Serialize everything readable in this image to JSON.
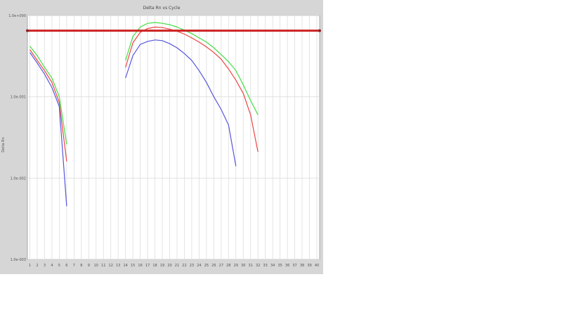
{
  "window": {
    "title": "Delta Rn vs Cycle"
  },
  "chart_data": {
    "type": "line",
    "title": "Delta Rn vs Cycle",
    "xlabel": "",
    "ylabel": "Delta Rn",
    "x_ticks": [
      "1",
      "2",
      "3",
      "4",
      "5",
      "6",
      "7",
      "8",
      "9",
      "10",
      "11",
      "12",
      "13",
      "14",
      "15",
      "16",
      "17",
      "18",
      "19",
      "20",
      "21",
      "22",
      "23",
      "24",
      "25",
      "26",
      "27",
      "28",
      "29",
      "30",
      "31",
      "32",
      "33",
      "34",
      "35",
      "36",
      "37",
      "38",
      "39",
      "40"
    ],
    "y_ticks": [
      "1.0e-003",
      "1.0e-002",
      "1.0e-001",
      "1.0e+000"
    ],
    "y_scale": "log",
    "ylim": [
      0.001,
      1
    ],
    "xlim": [
      1,
      40
    ],
    "grid": true,
    "threshold": 0.65,
    "colors": {
      "threshold": "#cc2222",
      "green": "#44dd44",
      "red": "#ee4444",
      "blue": "#5555dd",
      "grid": "#dddddd"
    },
    "series": [
      {
        "color": "green",
        "segments": [
          {
            "x": [
              1,
              2,
              3,
              4,
              5,
              6
            ],
            "y": [
              0.42,
              0.32,
              0.23,
              0.17,
              0.1,
              0.026
            ]
          },
          {
            "x": [
              14,
              15,
              16,
              17,
              18,
              19,
              20,
              21,
              22,
              23,
              24,
              25,
              26,
              27,
              28,
              29,
              30,
              31,
              32
            ],
            "y": [
              0.28,
              0.55,
              0.72,
              0.8,
              0.82,
              0.8,
              0.77,
              0.72,
              0.66,
              0.6,
              0.53,
              0.47,
              0.4,
              0.33,
              0.27,
              0.21,
              0.14,
              0.09,
              0.06
            ]
          }
        ]
      },
      {
        "color": "red",
        "segments": [
          {
            "x": [
              1,
              2,
              3,
              4,
              5,
              6
            ],
            "y": [
              0.38,
              0.28,
              0.21,
              0.15,
              0.085,
              0.016
            ]
          },
          {
            "x": [
              14,
              15,
              16,
              17,
              18,
              19,
              20,
              21,
              22,
              23,
              24,
              25,
              26,
              27,
              28,
              29,
              30,
              31,
              32
            ],
            "y": [
              0.23,
              0.46,
              0.62,
              0.69,
              0.72,
              0.71,
              0.68,
              0.64,
              0.59,
              0.53,
              0.47,
              0.41,
              0.35,
              0.29,
              0.22,
              0.16,
              0.11,
              0.06,
              0.021
            ]
          }
        ]
      },
      {
        "color": "blue",
        "segments": [
          {
            "x": [
              1,
              2,
              3,
              4,
              5,
              6
            ],
            "y": [
              0.35,
              0.26,
              0.19,
              0.13,
              0.076,
              0.0045
            ]
          },
          {
            "x": [
              14,
              15,
              16,
              17,
              18,
              19,
              20,
              21,
              22,
              23,
              24,
              25,
              26,
              27,
              28,
              29
            ],
            "y": [
              0.17,
              0.32,
              0.44,
              0.48,
              0.5,
              0.49,
              0.45,
              0.4,
              0.34,
              0.28,
              0.21,
              0.15,
              0.1,
              0.07,
              0.045,
              0.014
            ]
          }
        ]
      }
    ]
  }
}
